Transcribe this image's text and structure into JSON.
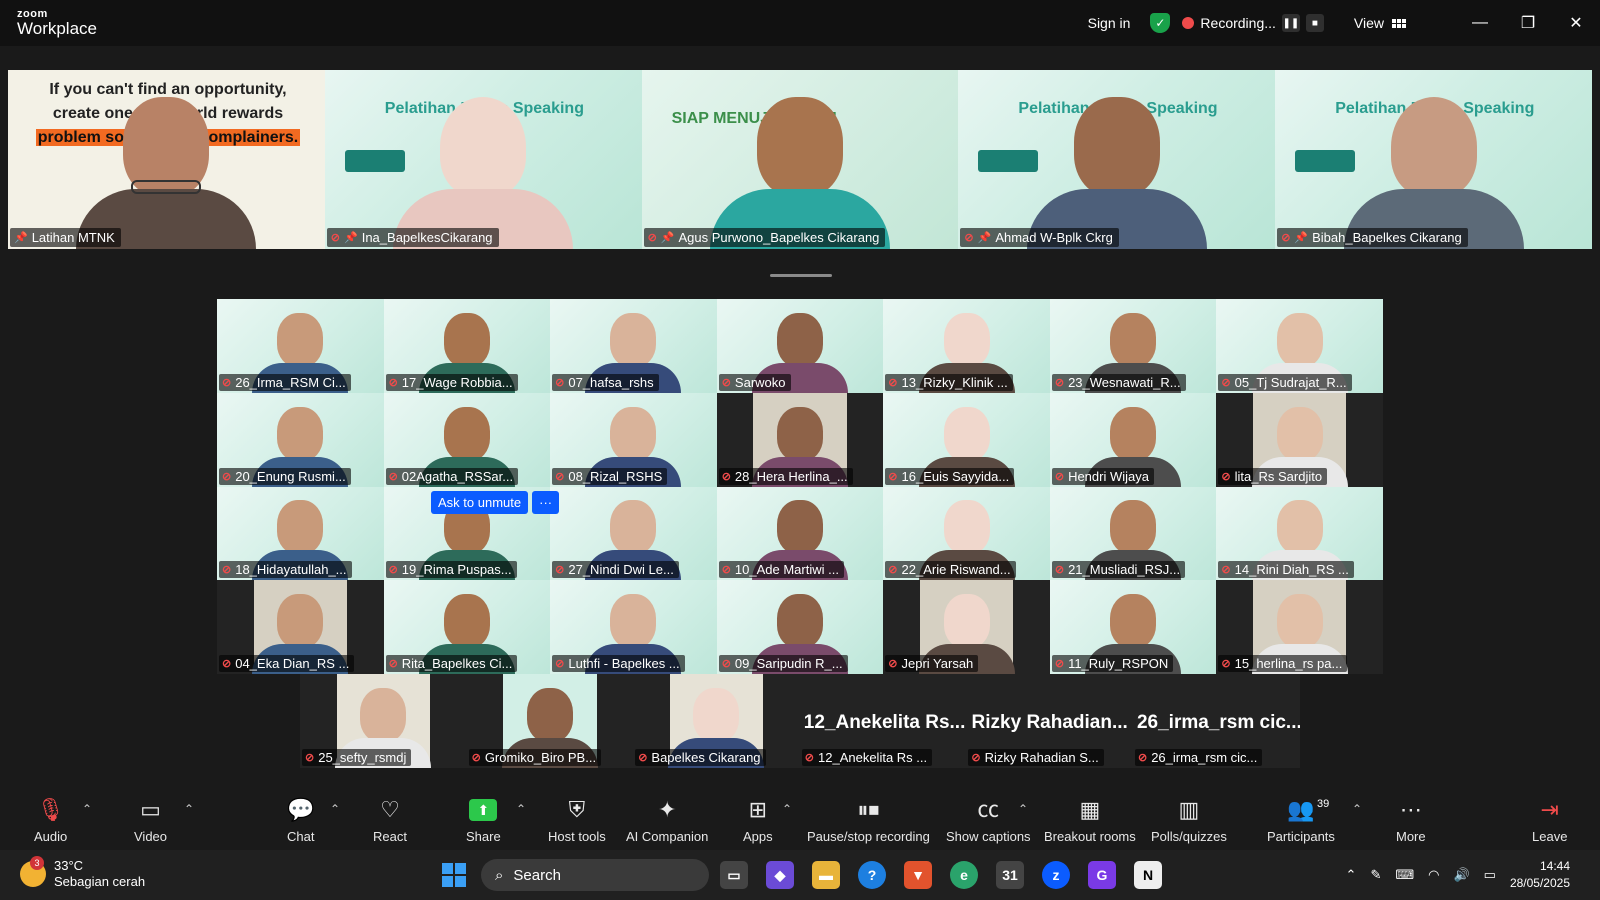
{
  "app": {
    "logo_line1": "zoom",
    "logo_line2": "Workplace"
  },
  "titlebar": {
    "sign_in": "Sign in",
    "recording_label": "Recording...",
    "view_label": "View"
  },
  "strip": [
    {
      "name": "Latihan MTNK",
      "active": true,
      "quote_parts": [
        "If you can't find an opportunity,",
        "create one. The world rewards",
        "problem solvers, not complainers."
      ]
    },
    {
      "name": "Ina_BapelkesCikarang",
      "slide_title": "Pelatihan Public Speaking"
    },
    {
      "name": "Agus Purwono_Bapelkes Cikarang",
      "slide_title": "SIAP MENUJU WBBM"
    },
    {
      "name": "Ahmad W-Bplk Ckrg",
      "slide_title": "Pelatihan Public Speaking"
    },
    {
      "name": "Bibah_Bapelkes Cikarang",
      "slide_title": "Pelatihan Public Speaking"
    }
  ],
  "gallery": [
    "26_Irma_RSM Ci...",
    "17_Wage Robbia...",
    "07_hafsa_rshs",
    "Sarwoko",
    "13_Rizky_Klinik ...",
    "23_Wesnawati_R...",
    "05_Tj Sudrajat_R...",
    "20_Enung Rusmi...",
    "02Agatha_RSSar...",
    "08_Rizal_RSHS",
    "28_Hera Herlina_...",
    "16_Euis Sayyida...",
    "Hendri Wijaya",
    "lita_Rs Sardjito",
    "18_Hidayatullah_...",
    "19_Rima Puspas...",
    "27_Nindi Dwi Le...",
    "10_Ade Martiwi ...",
    "22_Arie Riswand...",
    "21_Musliadi_RSJ...",
    "14_Rini Diah_RS ...",
    "04_Eka Dian_RS ...",
    "Rita_Bapelkes Ci...",
    "Luthfi - Bapelkes ...",
    "09_Saripudin R_...",
    "Jepri Yarsah",
    "11_Ruly_RSPON",
    "15_herlina_rs pa..."
  ],
  "last_row": [
    {
      "name": "25_sefty_rsmdj",
      "big": ""
    },
    {
      "name": "Gromiko_Biro PB...",
      "big": ""
    },
    {
      "name": "Bapelkes Cikarang",
      "big": ""
    },
    {
      "name": "12_Anekelita Rs ...",
      "big": "12_Anekelita Rs..."
    },
    {
      "name": "Rizky Rahadian S...",
      "big": "Rizky Rahadian..."
    },
    {
      "name": "26_irma_rsm cic...",
      "big": "26_irma_rsm cic..."
    }
  ],
  "hover": {
    "ask_unmute": "Ask to unmute",
    "more": "···"
  },
  "toolbar": {
    "audio": "Audio",
    "video": "Video",
    "chat": "Chat",
    "react": "React",
    "share": "Share",
    "host_tools": "Host tools",
    "ai_companion": "AI Companion",
    "apps": "Apps",
    "pause_recording": "Pause/stop recording",
    "captions": "Show captions",
    "breakout": "Breakout rooms",
    "polls": "Polls/quizzes",
    "participants": "Participants",
    "participants_count": "39",
    "more": "More",
    "leave": "Leave"
  },
  "taskbar": {
    "weather_temp": "33°C",
    "weather_desc": "Sebagian cerah",
    "weather_badge": "3",
    "search": "Search",
    "time": "14:44",
    "date": "28/05/2025"
  },
  "colors": {
    "accent_green": "#2cc84b",
    "zoom_blue": "#0b5cff",
    "mute_red": "#ef4b4b"
  }
}
